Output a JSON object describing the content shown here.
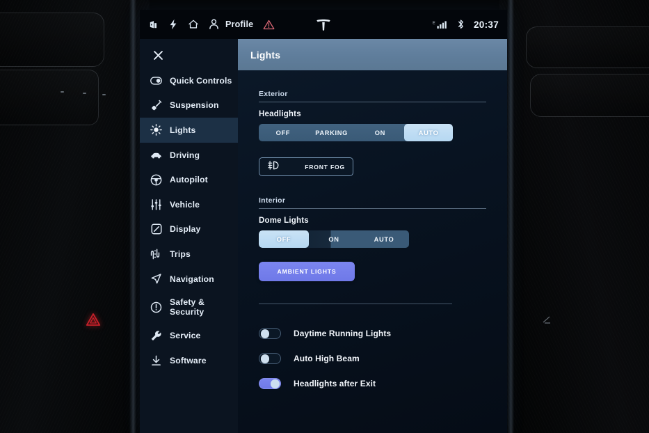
{
  "statusbar": {
    "icons_left": [
      {
        "name": "door-lock-icon",
        "label": ""
      },
      {
        "name": "charging-bolt-icon",
        "label": ""
      },
      {
        "name": "home-icon",
        "label": ""
      }
    ],
    "profile_label": "Profile",
    "warning_icon": "warning-triangle-icon",
    "brand_logo": "tesla-logo",
    "signal_icon": "cellular-signal-icon",
    "bluetooth_icon": "bluetooth-icon",
    "time": "20:37"
  },
  "sidebar": {
    "close_label": "",
    "items": [
      {
        "label": "Quick Controls",
        "icon": "toggle-switch-icon",
        "active": false
      },
      {
        "label": "Suspension",
        "icon": "shock-absorber-icon",
        "active": false
      },
      {
        "label": "Lights",
        "icon": "sun-brightness-icon",
        "active": true
      },
      {
        "label": "Driving",
        "icon": "car-icon",
        "active": false
      },
      {
        "label": "Autopilot",
        "icon": "steering-wheel-icon",
        "active": false
      },
      {
        "label": "Vehicle",
        "icon": "sliders-icon",
        "active": false
      },
      {
        "label": "Display",
        "icon": "display-icon",
        "active": false
      },
      {
        "label": "Trips",
        "icon": "winding-road-icon",
        "active": false
      },
      {
        "label": "Navigation",
        "icon": "navigation-arrow-icon",
        "active": false
      },
      {
        "label": "Safety &\nSecurity",
        "icon": "alert-circle-icon",
        "active": false
      },
      {
        "label": "Service",
        "icon": "wrench-icon",
        "active": false
      },
      {
        "label": "Software",
        "icon": "download-icon",
        "active": false
      }
    ]
  },
  "panel": {
    "title": "Lights",
    "exterior": {
      "section_label": "Exterior",
      "headlights": {
        "label": "Headlights",
        "options": [
          "OFF",
          "PARKING",
          "ON",
          "AUTO"
        ],
        "selected": "AUTO"
      },
      "front_fog": {
        "label": "FRONT FOG",
        "icon": "fog-light-icon",
        "active": false
      }
    },
    "interior": {
      "section_label": "Interior",
      "dome_lights": {
        "label": "Dome Lights",
        "options": [
          "OFF",
          "ON",
          "AUTO"
        ],
        "selected": "OFF"
      },
      "ambient_lights": {
        "label": "AMBIENT LIGHTS",
        "active": true
      }
    },
    "toggles": [
      {
        "label": "Daytime Running Lights",
        "on": false
      },
      {
        "label": "Auto High Beam",
        "on": false
      },
      {
        "label": "Headlights after Exit",
        "on": true
      }
    ]
  },
  "colors": {
    "accent_purple": "#7b85ef",
    "selected_blue": "#bedbf3",
    "sidebar_bg": "#0b1420",
    "sidebar_active": "#1c3045",
    "header_bar": "#607e9c",
    "hazard_red": "#c6202a"
  }
}
